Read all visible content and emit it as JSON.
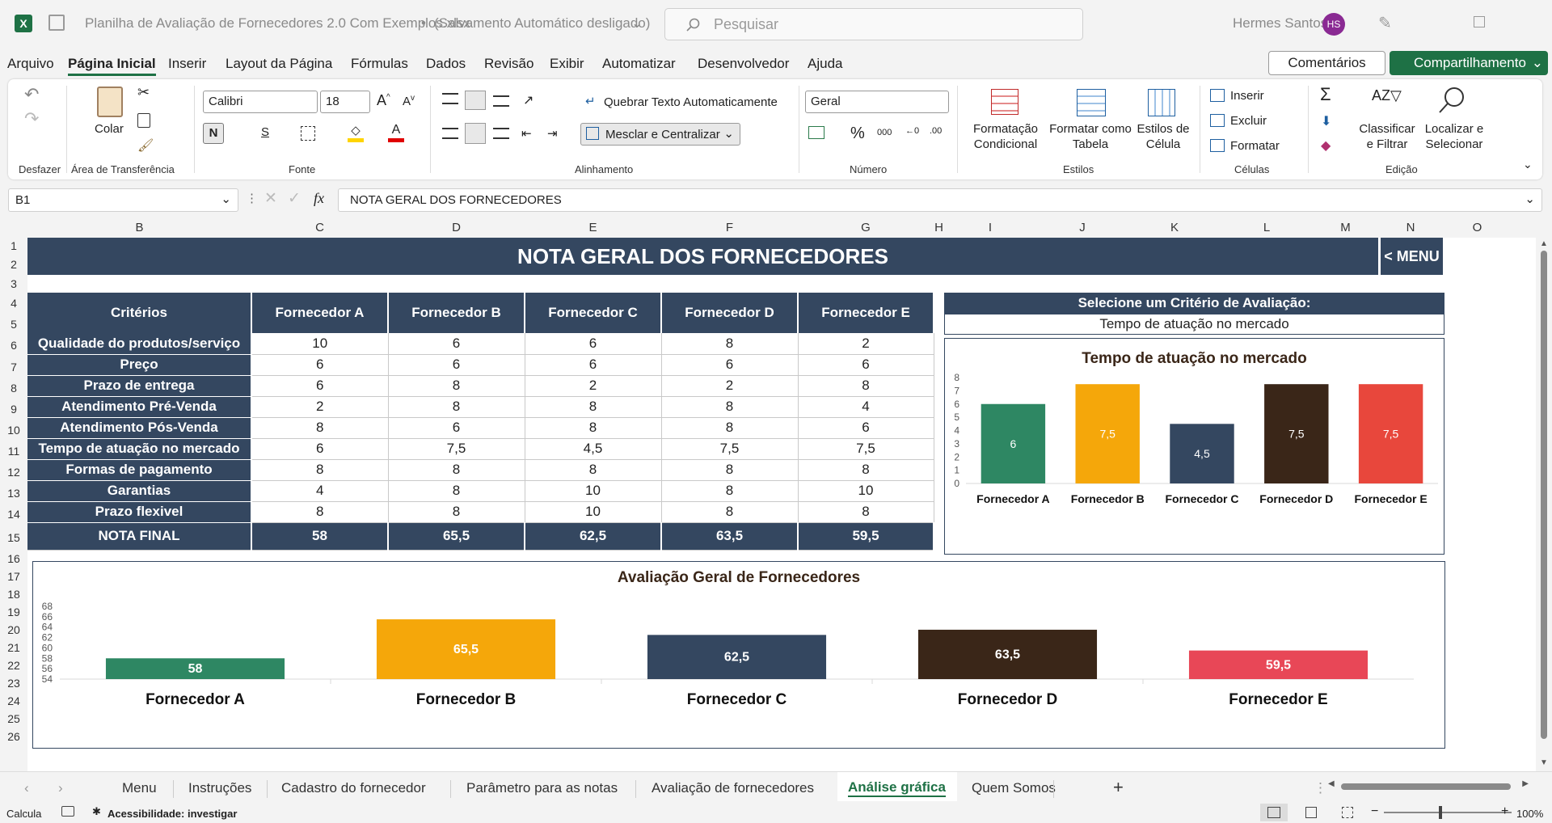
{
  "titlebar": {
    "filename": "Planilha de Avaliação de Fornecedores 2.0 Com Exemplos.xlsx",
    "separator": "•",
    "autosave": "(Salvamento Automático desligado)",
    "search_placeholder": "Pesquisar",
    "user_name": "Hermes Santos",
    "user_initials": "HS"
  },
  "menu": {
    "items": [
      "Arquivo",
      "Página Inicial",
      "Inserir",
      "Layout da Página",
      "Fórmulas",
      "Dados",
      "Revisão",
      "Exibir",
      "Automatizar",
      "Desenvolvedor",
      "Ajuda"
    ],
    "active": "Página Inicial",
    "comments": "Comentários",
    "share": "Compartilhamento"
  },
  "ribbon": {
    "undo_label": "Desfazer",
    "clipboard": {
      "paste": "Colar",
      "label": "Área de Transferência"
    },
    "font": {
      "name": "Calibri",
      "size": "18",
      "bold": "N",
      "underline": "S",
      "label": "Fonte"
    },
    "alignment": {
      "wrap": "Quebrar Texto Automaticamente",
      "merge": "Mesclar e Centralizar",
      "label": "Alinhamento"
    },
    "number": {
      "format": "Geral",
      "label": "Número"
    },
    "styles": {
      "conditional": "Formatação Condicional",
      "as_table": "Formatar como Tabela",
      "cell_styles": "Estilos de Célula",
      "label": "Estilos"
    },
    "cells": {
      "insert": "Inserir",
      "delete": "Excluir",
      "format": "Formatar",
      "label": "Células"
    },
    "editing": {
      "sort": "Classificar e Filtrar",
      "find": "Localizar e Selecionar",
      "label": "Edição"
    }
  },
  "formula_bar": {
    "cell_ref": "B1",
    "fx": "fx",
    "content": "NOTA GERAL DOS FORNECEDORES"
  },
  "columns": [
    "B",
    "C",
    "D",
    "E",
    "F",
    "G",
    "H",
    "I",
    "J",
    "K",
    "L",
    "M",
    "N",
    "O"
  ],
  "rows": [
    "1",
    "2",
    "3",
    "4",
    "5",
    "6",
    "7",
    "8",
    "9",
    "10",
    "11",
    "12",
    "13",
    "14",
    "15",
    "16",
    "17",
    "18",
    "19",
    "20",
    "21",
    "22",
    "23",
    "24",
    "25",
    "26"
  ],
  "dashboard": {
    "title": "NOTA GERAL DOS FORNECEDORES",
    "menu_button": "< MENU",
    "table": {
      "header": [
        "Critérios",
        "Fornecedor A",
        "Fornecedor B",
        "Fornecedor C",
        "Fornecedor D",
        "Fornecedor E"
      ],
      "rows": [
        [
          "Qualidade do produtos/serviço",
          "10",
          "6",
          "6",
          "8",
          "2"
        ],
        [
          "Preço",
          "6",
          "6",
          "6",
          "6",
          "6"
        ],
        [
          "Prazo de entrega",
          "6",
          "8",
          "2",
          "2",
          "8"
        ],
        [
          "Atendimento Pré-Venda",
          "2",
          "8",
          "8",
          "8",
          "4"
        ],
        [
          "Atendimento Pós-Venda",
          "8",
          "6",
          "8",
          "8",
          "6"
        ],
        [
          "Tempo de atuação no mercado",
          "6",
          "7,5",
          "4,5",
          "7,5",
          "7,5"
        ],
        [
          "Formas de pagamento",
          "8",
          "8",
          "8",
          "8",
          "8"
        ],
        [
          "Garantias",
          "4",
          "8",
          "10",
          "8",
          "10"
        ],
        [
          "Prazo flexivel",
          "8",
          "8",
          "10",
          "8",
          "8"
        ]
      ],
      "final": [
        "NOTA FINAL",
        "58",
        "65,5",
        "62,5",
        "63,5",
        "59,5"
      ]
    },
    "selector": {
      "label": "Selecione um Critério de Avaliação:",
      "value": "Tempo de atuação no mercado"
    }
  },
  "chart_data": [
    {
      "type": "bar",
      "title": "Tempo de atuação no mercado",
      "categories": [
        "Fornecedor A",
        "Fornecedor B",
        "Fornecedor C",
        "Fornecedor D",
        "Fornecedor E"
      ],
      "values": [
        6,
        7.5,
        4.5,
        7.5,
        7.5
      ],
      "labels": [
        "6",
        "7,5",
        "4,5",
        "7,5",
        "7,5"
      ],
      "colors": [
        "#2e8763",
        "#f5a70a",
        "#344760",
        "#3a2618",
        "#e8473c"
      ],
      "ylim": [
        0,
        8
      ],
      "yticks": [
        "0",
        "1",
        "2",
        "3",
        "4",
        "5",
        "6",
        "7",
        "8"
      ]
    },
    {
      "type": "bar",
      "title": "Avaliação Geral de Fornecedores",
      "categories": [
        "Fornecedor A",
        "Fornecedor B",
        "Fornecedor C",
        "Fornecedor D",
        "Fornecedor E"
      ],
      "values": [
        58,
        65.5,
        62.5,
        63.5,
        59.5
      ],
      "labels": [
        "58",
        "65,5",
        "62,5",
        "63,5",
        "59,5"
      ],
      "colors": [
        "#2e8763",
        "#f5a70a",
        "#344760",
        "#3a2618",
        "#e84757"
      ],
      "ylim": [
        54,
        68
      ],
      "yticks": [
        "54",
        "56",
        "58",
        "60",
        "62",
        "64",
        "66",
        "68"
      ]
    }
  ],
  "tabs": {
    "items": [
      "Menu",
      "Instruções",
      "Cadastro do fornecedor",
      "Parâmetro para as notas",
      "Avaliação de fornecedores",
      "Análise gráfica",
      "Quem Somos"
    ],
    "active": "Análise gráfica",
    "add": "+"
  },
  "status": {
    "mode": "Calcula",
    "accessibility": "Acessibilidade: investigar",
    "zoom": "100%"
  },
  "colors": {
    "navy": "#344760",
    "excel_green": "#1e7145"
  }
}
